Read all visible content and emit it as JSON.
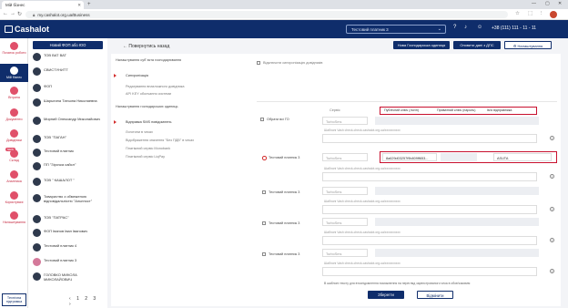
{
  "browser": {
    "tab_title": "Мій бізнес",
    "url": "my.cashalot.org.ua/Business",
    "window_controls": [
      "—",
      "▢",
      "✕"
    ]
  },
  "app": {
    "logo_text": "Cashalot",
    "search_placeholder": "Тестовий платник 3",
    "phone": "+38 (111) 111 - 11 - 11"
  },
  "sidenav": {
    "items": [
      {
        "label": "Початок роботи"
      },
      {
        "label": "Мій бізнес"
      },
      {
        "label": "Вітрина"
      },
      {
        "label": "Документи"
      },
      {
        "label": "Довідники"
      },
      {
        "label": "Склад",
        "badge": "NEW"
      },
      {
        "label": "Аналітика"
      },
      {
        "label": "Користувачі"
      },
      {
        "label": "Налаштування"
      }
    ],
    "support": "Технічна підтримка"
  },
  "companies": {
    "new_button": "Новий ФОП або ЮО",
    "items": [
      "ТОВ ВАТ ВАТ",
      "СВИСТУНИТТ",
      "ФОП",
      "Шарыгина Татьяна Николаевна",
      "Мирний Олександр Миколайович",
      "ТОВ \"ПАГАН\"",
      "Тестовий платник",
      "ПП \"Зірочка сайсл\"",
      "ТОВ \" КАШАЛОТ \"",
      "Товариство з обмеженою відповідальністю \"Альпност\"",
      "ТОВ \"ПАТРАС\"",
      "ФОП Іванов Іван Іванович",
      "Тестовий платник 4",
      "Тестовий платник 3",
      "ГОЛОВКО МИКОЛА МИКОЛАЙОВИЧ"
    ],
    "pages": [
      "1",
      "2",
      "3"
    ]
  },
  "main": {
    "back": "Повернутись назад",
    "buttons": {
      "new_unit": "Нова Господарська одиниця",
      "update_dps": "Оновити дані з ДПС",
      "settings": "Налаштування"
    },
    "sections": {
      "settings_title": "Налаштування суб`єкта господарювання",
      "sync": "Синхронізація",
      "sync_options": [
        "Редагування впаєложного довідника",
        "API KEY оболчання системи"
      ],
      "disable_sync": "Відключити синхронізацію довідників",
      "units_title": "Налаштування господарських одиниць",
      "sms": "Відправка SMS повідомлень",
      "sms_options": [
        "Логотипи в чеках",
        "Відображення значення \"Без ПДВ\" в чеках",
        "Платіжний сервіс Monobank",
        "Платіжний сервіс LiqPay"
      ],
      "select_all": "Обрати всі ГО",
      "service_label": "Сервіс",
      "col_public": "Публічний ключ (логін)",
      "col_private": "Приватний ключ (пароль)",
      "col_sender": "Ім'я відправника",
      "service_value": "TurboSms",
      "hint": "Шаблоні Vash check-check-cashalot.org.ua/xxxxxxxxxx",
      "key_value": "8a629d03257f9b809ff653...",
      "sender_value": "ASUTA",
      "units": [
        "Тестовий платник 3",
        "Тестовий платник 3",
        "Тестовий платник 3",
        "Тестовий платник 3"
      ],
      "footer_note": "В шаблоні тексту для втоспідомлення поможнення на перегляд зареєстрованого чека в обов'язковим",
      "save": "Зберегти",
      "cancel": "Відмінити"
    }
  }
}
